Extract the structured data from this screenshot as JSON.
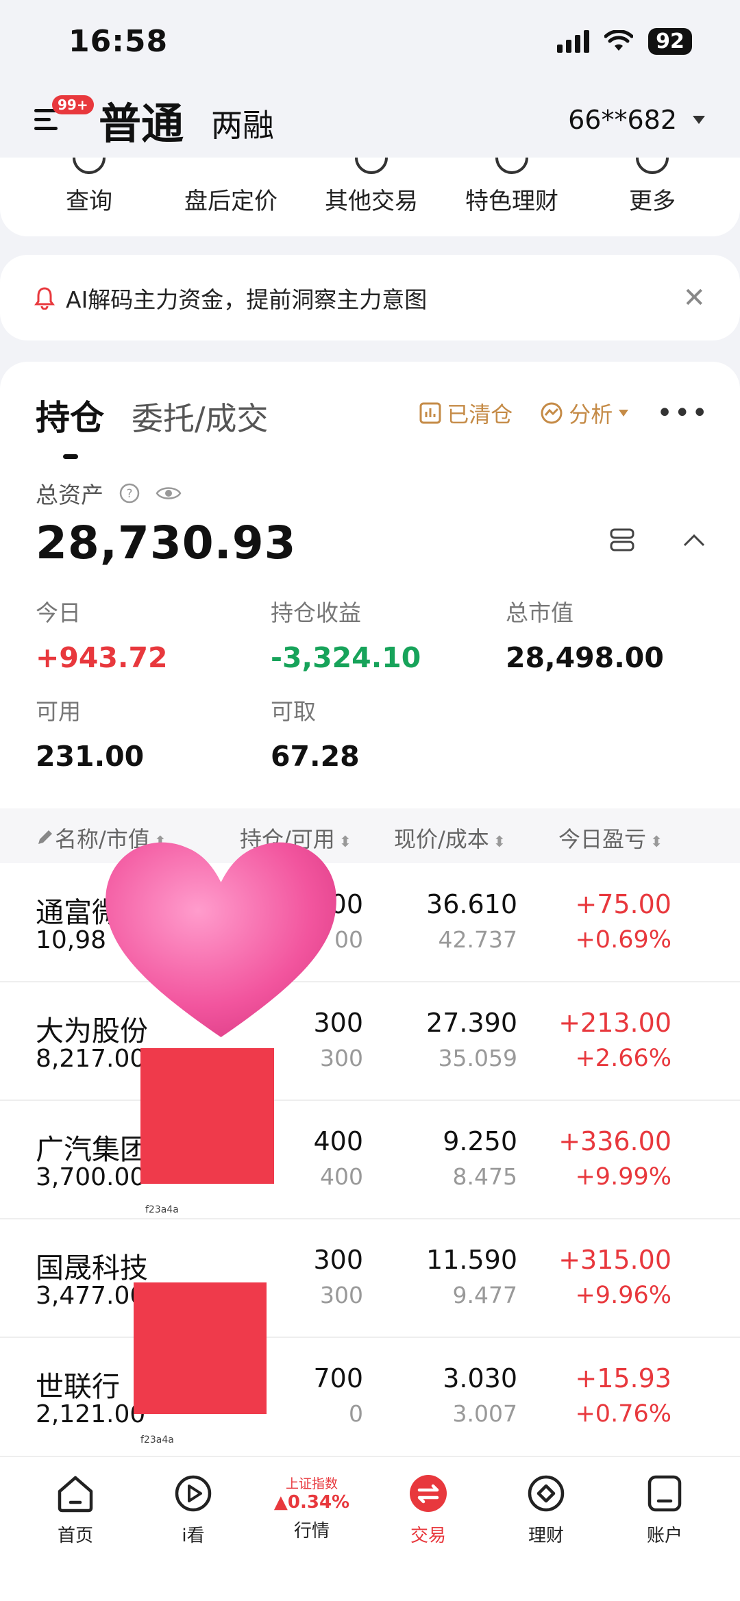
{
  "status_bar": {
    "time": "16:58",
    "battery": "92"
  },
  "header": {
    "badge": "99+",
    "mode_active": "普通",
    "mode_other": "两融",
    "account": "66**682"
  },
  "quick_menu": [
    "查询",
    "盘后定价",
    "其他交易",
    "特色理财",
    "更多"
  ],
  "notice": {
    "text": "AI解码主力资金，提前洞察主力意图"
  },
  "tabs": {
    "active": "持仓",
    "other": "委托/成交"
  },
  "actions": {
    "cleared": "已清仓",
    "analysis": "分析"
  },
  "asset": {
    "label": "总资产",
    "value": "28,730.93"
  },
  "stats": {
    "today_label": "今日",
    "today_value": "+943.72",
    "position_label": "持仓收益",
    "position_value": "-3,324.10",
    "market_label": "总市值",
    "market_value": "28,498.00",
    "available_label": "可用",
    "available_value": "231.00",
    "withdrawable_label": "可取",
    "withdrawable_value": "67.28"
  },
  "table": {
    "headers": [
      "名称/市值",
      "持仓/可用",
      "现价/成本",
      "今日盈亏"
    ],
    "rows": [
      {
        "name": "通富微",
        "market_value": "10,98",
        "qty": "00",
        "avail": "00",
        "price": "36.610",
        "cost": "42.737",
        "pnl": "+75.00",
        "pct": "+0.69%"
      },
      {
        "name": "大为股份",
        "market_value": "8,217.00",
        "qty": "300",
        "avail": "300",
        "price": "27.390",
        "cost": "35.059",
        "pnl": "+213.00",
        "pct": "+2.66%"
      },
      {
        "name": "广汽集团",
        "market_value": "3,700.00",
        "qty": "400",
        "avail": "400",
        "price": "9.250",
        "cost": "8.475",
        "pnl": "+336.00",
        "pct": "+9.99%"
      },
      {
        "name": "国晟科技",
        "market_value": "3,477.00",
        "qty": "300",
        "avail": "300",
        "price": "11.590",
        "cost": "9.477",
        "pnl": "+315.00",
        "pct": "+9.96%"
      },
      {
        "name": "世联行",
        "market_value": "2,121.00",
        "qty": "700",
        "avail": "0",
        "price": "3.030",
        "cost": "3.007",
        "pnl": "+15.93",
        "pct": "+0.76%"
      }
    ]
  },
  "redaction_tag": "f23a4a",
  "bottom_nav": {
    "home": "首页",
    "watch": "i看",
    "index_name": "上证指数",
    "index_value": "▲0.34%",
    "market": "行情",
    "trade": "交易",
    "finance": "理财",
    "account": "账户"
  }
}
